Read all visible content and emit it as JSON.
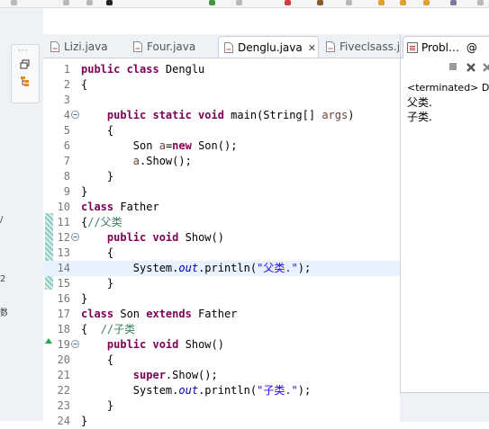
{
  "editor": {
    "tabs": [
      {
        "label": "Lizi.java",
        "active": false
      },
      {
        "label": "Four.java",
        "active": false
      },
      {
        "label": "Denglu.java",
        "active": true
      },
      {
        "label": "Fiveclsass.j",
        "active": false
      }
    ],
    "lines": [
      {
        "n": "1",
        "code": [
          [
            "kw",
            "public class"
          ],
          [
            "t",
            " Denglu"
          ]
        ]
      },
      {
        "n": "2",
        "code": [
          [
            "t",
            "{"
          ]
        ]
      },
      {
        "n": "3",
        "code": []
      },
      {
        "n": "4",
        "fold": true,
        "code": [
          [
            "t",
            "    "
          ],
          [
            "kw",
            "public static void"
          ],
          [
            "t",
            " main(String[] "
          ],
          [
            "lv",
            "args"
          ],
          [
            "t",
            ")"
          ]
        ]
      },
      {
        "n": "5",
        "code": [
          [
            "t",
            "    {"
          ]
        ]
      },
      {
        "n": "6",
        "code": [
          [
            "t",
            "        Son "
          ],
          [
            "lv",
            "a"
          ],
          [
            "t",
            "="
          ],
          [
            "kw",
            "new"
          ],
          [
            "t",
            " Son();"
          ]
        ]
      },
      {
        "n": "7",
        "code": [
          [
            "t",
            "        "
          ],
          [
            "lv",
            "a"
          ],
          [
            "t",
            ".Show();"
          ]
        ]
      },
      {
        "n": "8",
        "code": [
          [
            "t",
            "    }"
          ]
        ]
      },
      {
        "n": "9",
        "code": [
          [
            "t",
            "}"
          ]
        ]
      },
      {
        "n": "10",
        "code": [
          [
            "kw",
            "class"
          ],
          [
            "t",
            " Father"
          ]
        ]
      },
      {
        "n": "11",
        "changed": true,
        "code": [
          [
            "t",
            "{"
          ],
          [
            "cm",
            "//父类"
          ]
        ]
      },
      {
        "n": "12",
        "changed": true,
        "fold": true,
        "code": [
          [
            "t",
            "    "
          ],
          [
            "kw",
            "public void"
          ],
          [
            "t",
            " Show()"
          ]
        ]
      },
      {
        "n": "13",
        "changed": true,
        "code": [
          [
            "t",
            "    {"
          ]
        ]
      },
      {
        "n": "14",
        "changed": true,
        "current": true,
        "code": [
          [
            "t",
            "        System."
          ],
          [
            "fld",
            "out"
          ],
          [
            "t",
            ".println("
          ],
          [
            "str",
            "\"父类.\""
          ],
          [
            "t",
            ");"
          ]
        ]
      },
      {
        "n": "15",
        "changed": true,
        "code": [
          [
            "t",
            "    }"
          ]
        ]
      },
      {
        "n": "16",
        "code": [
          [
            "t",
            "}"
          ]
        ]
      },
      {
        "n": "17",
        "code": [
          [
            "kw",
            "class"
          ],
          [
            "t",
            " Son "
          ],
          [
            "kw",
            "extends"
          ],
          [
            "t",
            " Father"
          ]
        ]
      },
      {
        "n": "18",
        "code": [
          [
            "t",
            "{  "
          ],
          [
            "cm",
            "//子类"
          ]
        ]
      },
      {
        "n": "19",
        "fold": true,
        "override": true,
        "code": [
          [
            "t",
            "    "
          ],
          [
            "kw",
            "public void"
          ],
          [
            "t",
            " Show()"
          ]
        ]
      },
      {
        "n": "20",
        "code": [
          [
            "t",
            "    {"
          ]
        ]
      },
      {
        "n": "21",
        "code": [
          [
            "t",
            "        "
          ],
          [
            "kw",
            "super"
          ],
          [
            "t",
            ".Show();"
          ]
        ]
      },
      {
        "n": "22",
        "code": [
          [
            "t",
            "        System."
          ],
          [
            "fld",
            "out"
          ],
          [
            "t",
            ".println("
          ],
          [
            "str",
            "\"子类.\""
          ],
          [
            "t",
            ");"
          ]
        ]
      },
      {
        "n": "23",
        "code": [
          [
            "t",
            "    }"
          ]
        ]
      },
      {
        "n": "24",
        "code": [
          [
            "t",
            "}"
          ]
        ]
      }
    ]
  },
  "panel": {
    "tab_label": "Probl…",
    "tab_more": "@",
    "terminated_label": "<terminated> D",
    "output": [
      "父类.",
      "子类."
    ]
  },
  "left": {
    "dock_dots": "···",
    "glyphs": [
      "/",
      "2",
      "数"
    ]
  },
  "colors": {
    "keyword": "#7f0055",
    "string": "#2a00ff",
    "comment": "#3f7f5f",
    "field": "#0000c0",
    "current_line": "#e8f2fe"
  }
}
